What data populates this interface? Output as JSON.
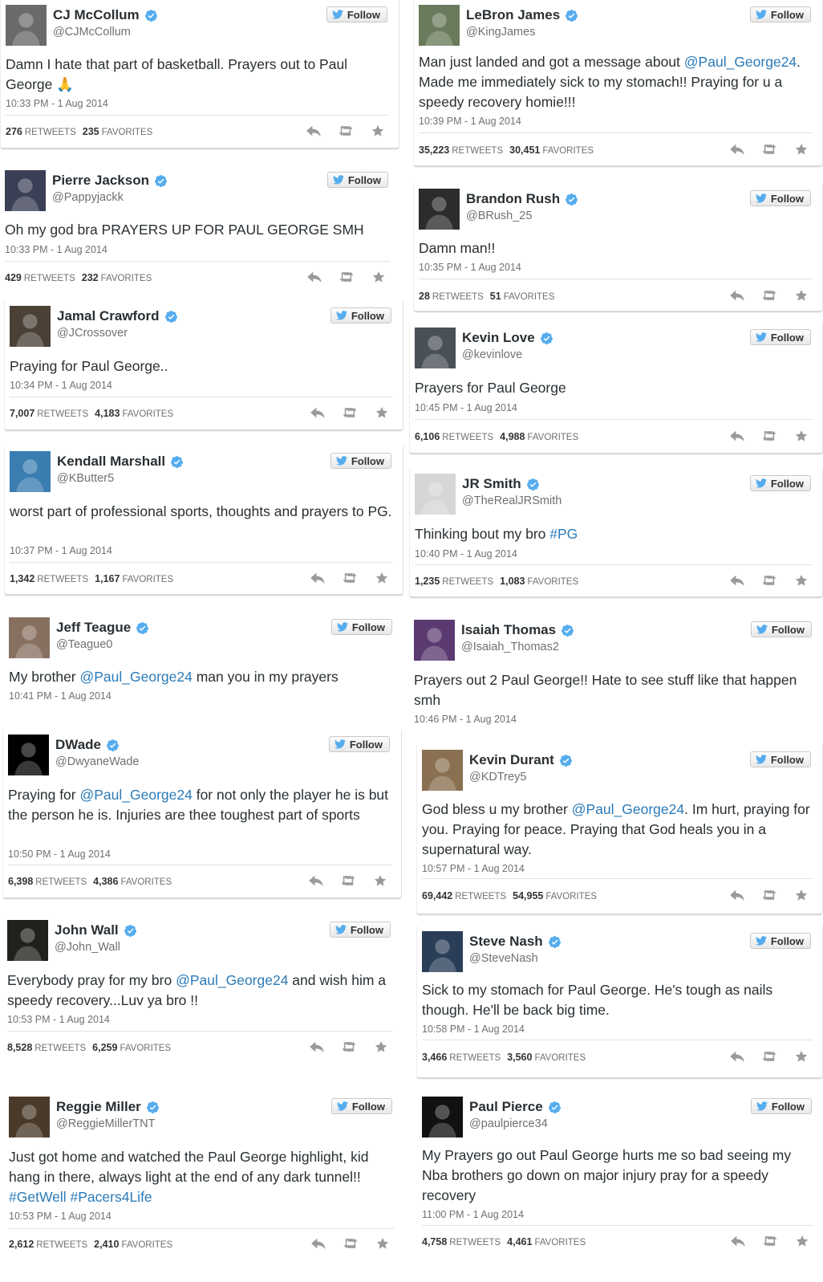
{
  "follow_label": "Follow",
  "retweets_label": "RETWEETS",
  "favorites_label": "FAVORITES",
  "colors": {
    "link": "#2b7bb9",
    "verified": "#55acee",
    "twitter_bird": "#55acee"
  },
  "tweets": [
    {
      "name": "CJ McCollum",
      "handle": "@CJMcCollum",
      "text": "Damn I hate that part of basketball. Prayers out to Paul George 🙏",
      "time": "10:33 PM - 1 Aug 2014",
      "retweets": "276",
      "favorites": "235"
    },
    {
      "name": "Pierre Jackson",
      "handle": "@Pappyjackk",
      "text": "Oh my god bra PRAYERS UP FOR PAUL GEORGE SMH",
      "time": "10:33 PM - 1 Aug 2014",
      "retweets": "429",
      "favorites": "232"
    },
    {
      "name": "Jamal Crawford",
      "handle": "@JCrossover",
      "text": "Praying for Paul George..",
      "time": "10:34 PM - 1 Aug 2014",
      "retweets": "7,007",
      "favorites": "4,183"
    },
    {
      "name": "Kendall Marshall",
      "handle": "@KButter5",
      "text": "worst part of professional sports, thoughts and prayers to PG.",
      "time": "10:37 PM - 1 Aug 2014",
      "retweets": "1,342",
      "favorites": "1,167"
    },
    {
      "name": "Jeff Teague",
      "handle": "@Teague0",
      "text_pre": "My brother ",
      "text_link": "@Paul_George24",
      "text_post": " man you in my prayers",
      "time": "10:41 PM - 1 Aug 2014"
    },
    {
      "name": "DWade",
      "handle": "@DwyaneWade",
      "text_pre": "Praying for ",
      "text_link": "@Paul_George24",
      "text_post": "  for not only the player he is but the person he is. Injuries are thee toughest part of sports",
      "time": "10:50 PM - 1 Aug 2014",
      "retweets": "6,398",
      "favorites": "4,386"
    },
    {
      "name": "John Wall",
      "handle": "@John_Wall",
      "text_pre": "Everybody pray for my bro ",
      "text_link": "@Paul_George24",
      "text_post": " and wish him a speedy recovery...Luv ya bro !!",
      "time": "10:53 PM - 1 Aug 2014",
      "retweets": "8,528",
      "favorites": "6,259"
    },
    {
      "name": "Reggie Miller",
      "handle": "@ReggieMillerTNT",
      "text_pre": "Just got home and watched the Paul George highlight, kid hang in there, always light at the end of any dark tunnel!! ",
      "text_link": "#GetWell #Pacers4Life",
      "text_post": "",
      "time": "10:53 PM - 1 Aug 2014",
      "retweets": "2,612",
      "favorites": "2,410"
    },
    {
      "name": "LeBron James",
      "handle": "@KingJames",
      "text_pre": "Man just landed and got a message about ",
      "text_link": "@Paul_George24",
      "text_post": ". Made me immediately sick to my stomach!! Praying for u a speedy recovery homie!!!",
      "time": "10:39 PM - 1 Aug 2014",
      "retweets": "35,223",
      "favorites": "30,451"
    },
    {
      "name": "Brandon Rush",
      "handle": "@BRush_25",
      "text": "Damn man!!",
      "time": "10:35 PM - 1 Aug 2014",
      "retweets": "28",
      "favorites": "51"
    },
    {
      "name": "Kevin Love",
      "handle": "@kevinlove",
      "text": "Prayers for Paul George",
      "time": "10:45 PM - 1 Aug 2014",
      "retweets": "6,106",
      "favorites": "4,988"
    },
    {
      "name": "JR Smith",
      "handle": "@TheRealJRSmith",
      "text_pre": "Thinking bout my bro ",
      "text_link": "#PG",
      "text_post": "",
      "time": "10:40 PM - 1 Aug 2014",
      "retweets": "1,235",
      "favorites": "1,083"
    },
    {
      "name": "Isaiah Thomas",
      "handle": "@Isaiah_Thomas2",
      "text": "Prayers out 2 Paul George!! Hate to see stuff like that happen smh",
      "time": "10:46 PM - 1 Aug 2014"
    },
    {
      "name": "Kevin Durant",
      "handle": "@KDTrey5",
      "text_pre": "God bless u my brother ",
      "text_link": "@Paul_George24",
      "text_post": ". Im hurt, praying for you. Praying for peace. Praying that God heals you in a supernatural way.",
      "time": "10:57 PM - 1 Aug 2014",
      "retweets": "69,442",
      "favorites": "54,955"
    },
    {
      "name": "Steve Nash",
      "handle": "@SteveNash",
      "text": "Sick to my stomach for Paul George. He's tough as nails though. He'll be back big time.",
      "time": "10:58 PM - 1 Aug 2014",
      "retweets": "3,466",
      "favorites": "3,560"
    },
    {
      "name": "Paul Pierce",
      "handle": "@paulpierce34",
      "text": "My Prayers go out Paul George hurts me so bad seeing my Nba brothers go down on major injury pray for a speedy recovery",
      "time": "11:00 PM - 1 Aug 2014",
      "retweets": "4,758",
      "favorites": "4,461"
    }
  ]
}
